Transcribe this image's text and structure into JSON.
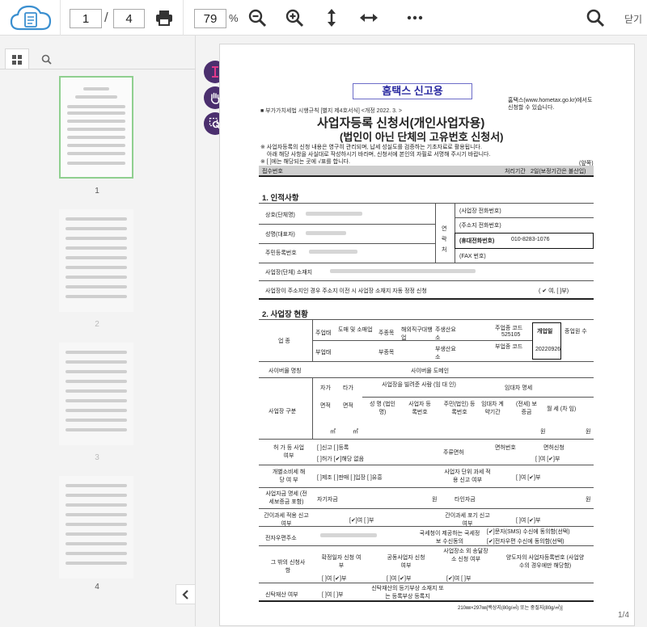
{
  "toolbar": {
    "current_page": "1",
    "separator": "/",
    "total_pages": "4",
    "zoom_value": "79",
    "zoom_unit": "%",
    "close_label": "닫기",
    "icons": [
      "cloud-document-icon",
      "print-icon",
      "zoom-out-icon",
      "zoom-in-icon",
      "fit-height-icon",
      "fit-width-icon",
      "more-icon",
      "search-icon"
    ]
  },
  "sidebar": {
    "tabs": [
      "thumbnails-icon",
      "search-icon"
    ],
    "thumbnails": [
      {
        "label": "1"
      },
      {
        "label": "2"
      },
      {
        "label": "3"
      },
      {
        "label": "4"
      }
    ]
  },
  "tools": [
    "text-select-icon",
    "hand-icon",
    "marquee-zoom-icon"
  ],
  "viewer": {
    "page_indicator": "1/4"
  },
  "document": {
    "stamp": "홈택스 신고용",
    "hometax_note_1": "홈택스(www.hometax.go.kr)에서도",
    "hometax_note_2": "신청할 수 있습니다.",
    "regulation": "■ 부가가치세법 시행규칙 [별지 제4호서식] <개정 2022. 3. >",
    "title": "사업자등록 신청서(개인사업자용)",
    "subtitle": "(법인이 아닌 단체의 고유번호 신청서)",
    "notice_1": "※ 사업자등록의 신청 내용은 영구히 관리되며, 납세 성실도를 검증하는 기초자료로 활용됩니다.",
    "notice_2": "아래 해당 사항을 사실대로 작성하시기 바라며, 신청서에 본인의 자필로 서명해 주시기 바랍니다.",
    "notice_3": "※ [ ]에는 해당되는 곳에 √표를 합니다.",
    "front_label": "(앞쪽)",
    "receipt_no": "접수번호",
    "processing_period": "처리기간",
    "processing_days": "2일(보정기간은 불산입)",
    "sec1": "1. 인적사항",
    "name_label": "상호(단체명)",
    "rep_label": "성명(대표자)",
    "rrn_label": "주민등록번호",
    "address_label": "사업장(단체) 소재지",
    "contact_label": "연락처",
    "phone_biz": "(사업장 전화번호)",
    "phone_home": "(주소지 전화번호)",
    "phone_mobile_label": "(휴대전화번호)",
    "phone_mobile": "010-8283-1076",
    "fax": "(FAX 번호)",
    "address_change_q": "사업장이 주소지인 경우 주소지 이전 시 사업장 소재지 자동 정정 신청",
    "address_change_a": "( ✔ 여, [ ]부)",
    "sec2": "2. 사업장 현황",
    "industry": "업 종",
    "main_biz": "주업태",
    "main_biz_val": "도매 및 소매업",
    "main_item": "주종목",
    "main_item_val": "해외직구대행업",
    "main_product": "주생산요소",
    "main_code_label": "주업종 코드",
    "main_code": "525105",
    "opening_date_label": "개업일",
    "opening_date": "20220926",
    "employees": "종업원 수",
    "sub_biz": "부업태",
    "sub_item": "부종목",
    "sub_product": "부생산요소",
    "sub_code_label": "부업종 코드",
    "cyber_name": "사이버몰 명칭",
    "cyber_domain": "사이버몰 도메인",
    "site_type": "사업장 구분",
    "own": "자가",
    "other": "타가",
    "area": "면적",
    "lessor_head": "사업장을 빌려준 사람 (임 대 인)",
    "lease_head": "임대차 명세",
    "lessor_name": "성 명 (법인명)",
    "lessor_brn": "사업자 등록번호",
    "lessor_rrn": "주민(법인) 등록번호",
    "lease_period": "임대차 계약기간",
    "deposit": "(전세) 보증금",
    "monthly": "월 세 (차 임)",
    "m2": "㎡",
    "won": "원",
    "license_q": "허 가 등 사업 여부",
    "license_opts_1": "[ ]신고  [ ]등록",
    "license_opts_2": "[ ]허가  [✔]해당 없음",
    "liquor": "주류면허",
    "license_no": "면허번호",
    "license_apply": "면허신청",
    "license_yn": "[ ]여  [✔]부",
    "excise_q": "개별소비세 해 당 여 부",
    "excise_opts": "[ ]제조 [ ]판매 [ ]입장 [ ]유흥",
    "simplified_q": "사업자 단위 과세 적용 신고 여부",
    "yn_no": "[ ]여  [✔]부",
    "funds_q": "사업자금 명세 (전세보증금 포함)",
    "own_funds": "자기자금",
    "borrowed": "타인자금",
    "simple_tax_q": "간이과세 적용 신고 여부",
    "yn_yes": "[✔]여  [ ]부",
    "simple_give_up": "간이과세 포기 신고 여부",
    "email_label": "전자우편주소",
    "nts_email": "국세청이 제공하는 국세정보 수신동의",
    "sms": "[✔]문자(SMS) 수신에 동의함(선택)",
    "email_opt": "[✔]전자우편 수신에 동의함(선택)",
    "other_apps": "그 밖의 신청사항",
    "confirm_date": "확정일자 신청 여부",
    "joint_biz": "공동사업자 신청 여부",
    "service_place": "사업장소 외 송달장소 신청 여부",
    "transferor": "양도자의 사업자등록번호 (사업양수의 경우에만 해당함)",
    "yn_no2": "[ ]여  [✔]부",
    "yn_yes2": "[✔]여  [ ]부",
    "trust_q": "신탁재산 여부",
    "trust_yn": "[ ]여  [ ]부",
    "trust_note": "신탁재산의 등기부상 소재지 또는 등록부상 등록지",
    "paper_size": "210㎜×297㎜[백상지(80g/㎡) 또는 중질지(80g/㎡)]"
  }
}
